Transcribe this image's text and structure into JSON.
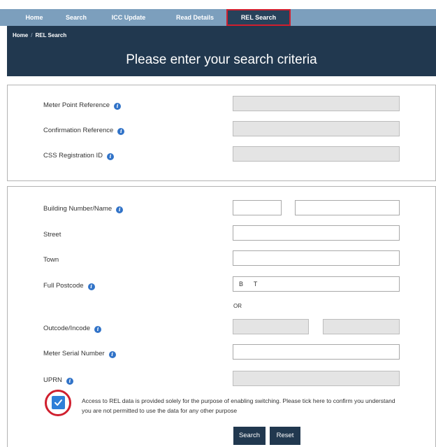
{
  "nav": {
    "items": [
      {
        "label": "Home"
      },
      {
        "label": "Search"
      },
      {
        "label": "ICC Update"
      },
      {
        "label": "Read Details"
      },
      {
        "label": "REL Search"
      }
    ],
    "active": "REL Search"
  },
  "breadcrumb": {
    "home": "Home",
    "current": "REL Search"
  },
  "page_title": "Please enter your search criteria",
  "info_icon_glyph": "i",
  "reference_panel": {
    "mpr_label": "Meter Point Reference",
    "mpr_value": "",
    "confirmation_label": "Confirmation Reference",
    "confirmation_value": "",
    "css_label": "CSS Registration ID",
    "css_value": ""
  },
  "address_panel": {
    "building_label": "Building Number/Name",
    "building_number_value": "",
    "building_name_value": "",
    "street_label": "Street",
    "street_value": "",
    "town_label": "Town",
    "town_value": "",
    "postcode_label": "Full Postcode",
    "postcode_value": "B    T",
    "or_text": "OR",
    "outcode_label": "Outcode/Incode",
    "outcode_value": "",
    "incode_value": "",
    "meter_serial_label": "Meter Serial Number",
    "meter_serial_value": "",
    "uprn_label": "UPRN",
    "uprn_value": ""
  },
  "consent": {
    "checked": true,
    "text": "Access to REL data is provided solely for the purpose of enabling switching. Please tick here to confirm you understand you are not permitted to use the data for any other purpose"
  },
  "buttons": {
    "search": "Search",
    "reset": "Reset"
  },
  "colors": {
    "nav_bg": "#7c9fbd",
    "banner_bg": "#21384f",
    "active_tab_outline": "#d01f2e",
    "info_icon": "#3173c8",
    "checkbox": "#2f7fd8",
    "disabled_field": "#e4e4e4"
  },
  "icons": [
    "info-icon",
    "checkmark-icon"
  ]
}
